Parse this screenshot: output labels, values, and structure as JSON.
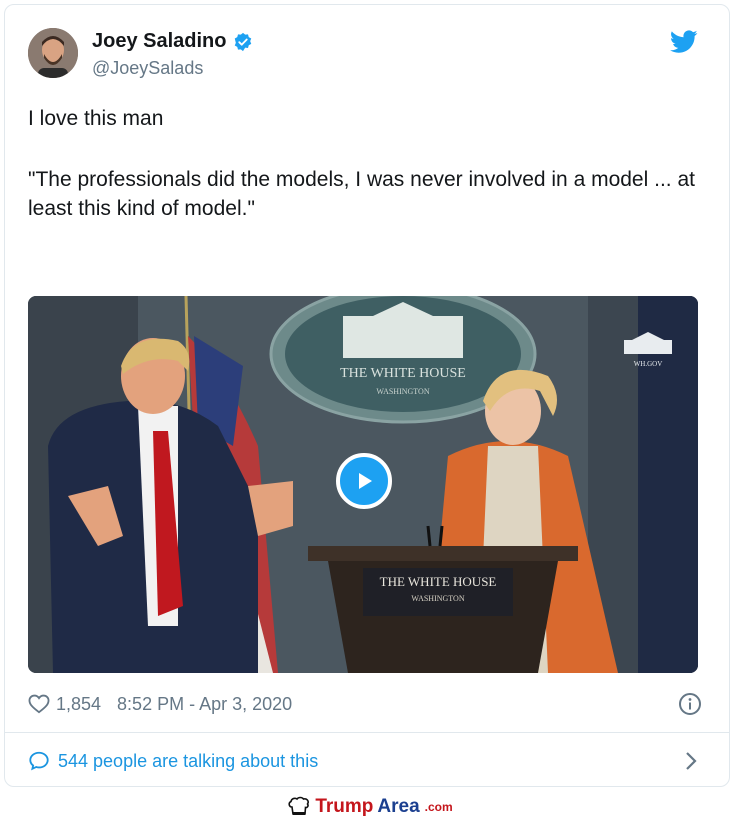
{
  "tweet": {
    "author": {
      "display_name": "Joey Saladino",
      "handle": "@JoeySalads",
      "verified": true
    },
    "text_line1": "I love this man",
    "text_quote": "\"The professionals did the models, I was never involved in a model ... at least this kind of model.\"",
    "media": {
      "seal_text": "THE WHITE HOUSE",
      "seal_subtext": "WASHINGTON",
      "podium_text": "THE WHITE HOUSE",
      "podium_subtext": "WASHINGTON",
      "watermark": "WH.GOV"
    },
    "likes": "1,854",
    "timestamp": "8:52 PM - Apr 3, 2020",
    "talking": "544 people are talking about this"
  },
  "footer": {
    "logo_part1": "Trump",
    "logo_part2": "Area",
    "logo_part3": ".com"
  },
  "colors": {
    "brand_blue": "#1da1f2",
    "link_blue": "#1b95e0",
    "muted": "#657786"
  },
  "icons": [
    "verified-badge-icon",
    "twitter-bird-icon",
    "play-icon",
    "heart-icon",
    "info-icon",
    "speech-bubble-icon",
    "chevron-right-icon",
    "chef-hat-logo-icon"
  ]
}
